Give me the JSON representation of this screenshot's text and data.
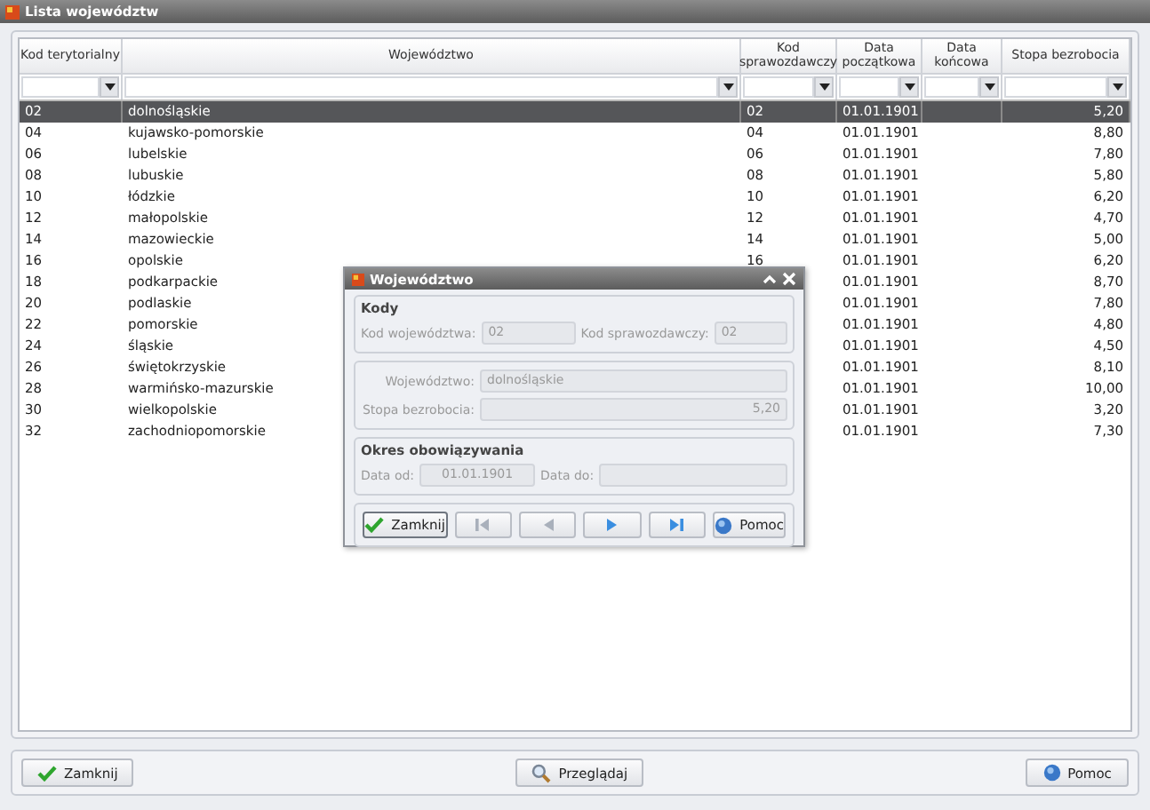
{
  "window": {
    "title": "Lista województw"
  },
  "table": {
    "columns": [
      {
        "label": "Kod terytorialny"
      },
      {
        "label": "Województwo"
      },
      {
        "label": "Kod sprawozdawczy"
      },
      {
        "label": "Data początkowa"
      },
      {
        "label": "Data końcowa"
      },
      {
        "label": "Stopa bezrobocia"
      }
    ],
    "rows": [
      {
        "kod_terytorialny": "02",
        "wojewodztwo": "dolnośląskie",
        "kod_sprawozdawczy": "02",
        "data_poczatkowa": "01.01.1901",
        "stopa_bezrobocia": "5,20",
        "selected": true
      },
      {
        "kod_terytorialny": "04",
        "wojewodztwo": "kujawsko-pomorskie",
        "kod_sprawozdawczy": "04",
        "data_poczatkowa": "01.01.1901",
        "stopa_bezrobocia": "8,80",
        "selected": false
      },
      {
        "kod_terytorialny": "06",
        "wojewodztwo": "lubelskie",
        "kod_sprawozdawczy": "06",
        "data_poczatkowa": "01.01.1901",
        "stopa_bezrobocia": "7,80",
        "selected": false
      },
      {
        "kod_terytorialny": "08",
        "wojewodztwo": "lubuskie",
        "kod_sprawozdawczy": "08",
        "data_poczatkowa": "01.01.1901",
        "stopa_bezrobocia": "5,80",
        "selected": false
      },
      {
        "kod_terytorialny": "10",
        "wojewodztwo": "łódzkie",
        "kod_sprawozdawczy": "10",
        "data_poczatkowa": "01.01.1901",
        "stopa_bezrobocia": "6,20",
        "selected": false
      },
      {
        "kod_terytorialny": "12",
        "wojewodztwo": "małopolskie",
        "kod_sprawozdawczy": "12",
        "data_poczatkowa": "01.01.1901",
        "stopa_bezrobocia": "4,70",
        "selected": false
      },
      {
        "kod_terytorialny": "14",
        "wojewodztwo": "mazowieckie",
        "kod_sprawozdawczy": "14",
        "data_poczatkowa": "01.01.1901",
        "stopa_bezrobocia": "5,00",
        "selected": false
      },
      {
        "kod_terytorialny": "16",
        "wojewodztwo": "opolskie",
        "kod_sprawozdawczy": "16",
        "data_poczatkowa": "01.01.1901",
        "stopa_bezrobocia": "6,20",
        "selected": false
      },
      {
        "kod_terytorialny": "18",
        "wojewodztwo": "podkarpackie",
        "data_poczatkowa": "01.01.1901",
        "stopa_bezrobocia": "8,70",
        "selected": false
      },
      {
        "kod_terytorialny": "20",
        "wojewodztwo": "podlaskie",
        "data_poczatkowa": "01.01.1901",
        "stopa_bezrobocia": "7,80",
        "selected": false
      },
      {
        "kod_terytorialny": "22",
        "wojewodztwo": "pomorskie",
        "data_poczatkowa": "01.01.1901",
        "stopa_bezrobocia": "4,80",
        "selected": false
      },
      {
        "kod_terytorialny": "24",
        "wojewodztwo": "śląskie",
        "data_poczatkowa": "01.01.1901",
        "stopa_bezrobocia": "4,50",
        "selected": false
      },
      {
        "kod_terytorialny": "26",
        "wojewodztwo": "świętokrzyskie",
        "data_poczatkowa": "01.01.1901",
        "stopa_bezrobocia": "8,10",
        "selected": false
      },
      {
        "kod_terytorialny": "28",
        "wojewodztwo": "warmińsko-mazurskie",
        "data_poczatkowa": "01.01.1901",
        "stopa_bezrobocia": "10,00",
        "selected": false
      },
      {
        "kod_terytorialny": "30",
        "wojewodztwo": "wielkopolskie",
        "data_poczatkowa": "01.01.1901",
        "stopa_bezrobocia": "3,20",
        "selected": false
      },
      {
        "kod_terytorialny": "32",
        "wojewodztwo": "zachodniopomorskie",
        "data_poczatkowa": "01.01.1901",
        "stopa_bezrobocia": "7,30",
        "selected": false
      }
    ]
  },
  "dialog": {
    "title": "Województwo",
    "kody": {
      "title": "Kody",
      "fields": [
        {
          "label": "Kod województwa:",
          "value": "02"
        },
        {
          "label": "Kod sprawozdawczy:",
          "value": "02"
        }
      ]
    },
    "details": {
      "fields": [
        {
          "label": "Województwo:",
          "value": "dolnośląskie"
        },
        {
          "label": "Stopa bezrobocia:",
          "value": "5,20"
        }
      ]
    },
    "okres": {
      "title": "Okres obowiązywania",
      "fields": [
        {
          "label": "Data od:",
          "value": "01.01.1901"
        },
        {
          "label": "Data do:"
        }
      ]
    },
    "close_button": {
      "label": "Zamknij"
    },
    "nav_buttons": [
      {
        "kind": "first",
        "disabled": true
      },
      {
        "kind": "prev",
        "disabled": true
      },
      {
        "kind": "next",
        "disabled": false
      },
      {
        "kind": "last",
        "disabled": false
      }
    ],
    "help_button": {
      "label": "Pomoc"
    }
  },
  "footer": {
    "close_button": {
      "label": "Zamknij"
    },
    "browse_button": {
      "label": "Przeglądaj"
    },
    "help_button": {
      "label": "Pomoc"
    }
  }
}
